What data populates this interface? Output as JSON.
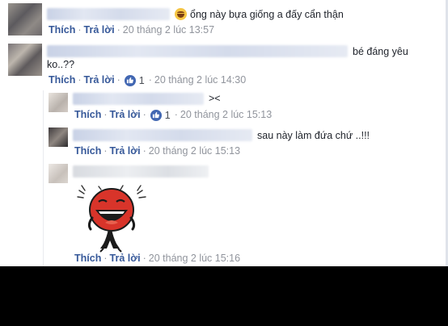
{
  "comments": [
    {
      "text": "ổng này bựa giống a đấy cẩn thận",
      "like": "Thích",
      "reply": "Trả lời",
      "time": "20 tháng 2 lúc 13:57"
    },
    {
      "text_end": "bé đáng yêu",
      "text_line2": "ko..??",
      "like": "Thích",
      "reply": "Trả lời",
      "reactions": "1",
      "time": "20 tháng 2 lúc 14:30"
    }
  ],
  "replies": [
    {
      "text": "><",
      "like": "Thích",
      "reply": "Trả lời",
      "reactions": "1",
      "time": "20 tháng 2 lúc 15:13"
    },
    {
      "text": "sau này làm đứa chứ ..!!!",
      "like": "Thích",
      "reply": "Trả lời",
      "time": "20 tháng 2 lúc 15:13"
    },
    {
      "like": "Thích",
      "reply": "Trả lời",
      "time": "20 tháng 2 lúc 15:16"
    }
  ],
  "icons": {
    "laugh": "laughing-emoji-icon",
    "like_reaction": "thumbs-up-icon",
    "sticker": "laughing-sticker"
  },
  "colors": {
    "link": "#365899",
    "meta": "#90949c",
    "reaction": "#4267b2",
    "sticker_red": "#d8342a"
  }
}
